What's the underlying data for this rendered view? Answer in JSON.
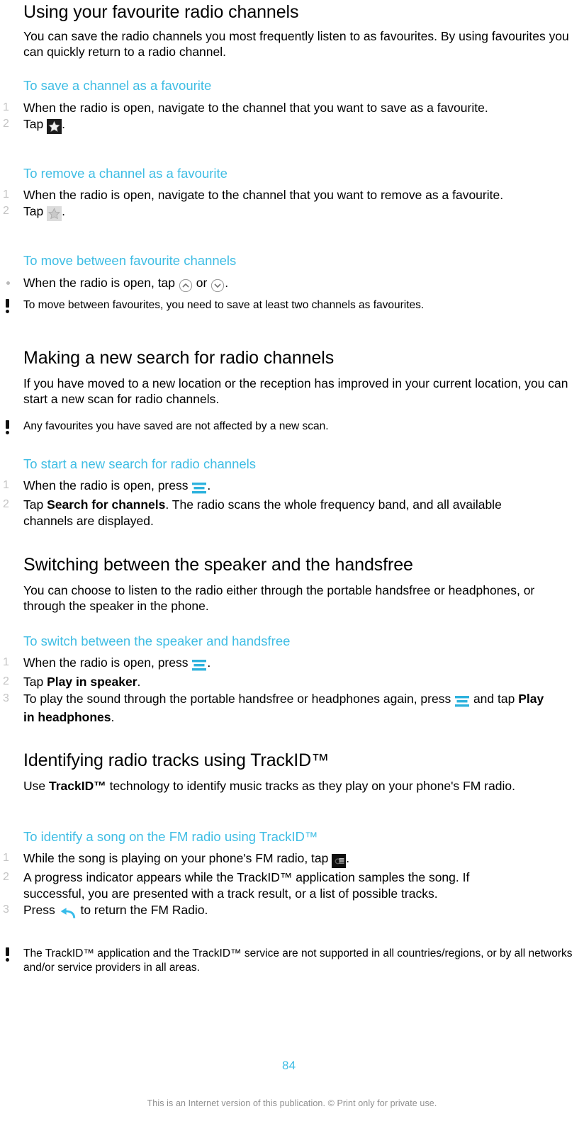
{
  "page": {
    "number": "84",
    "footer_note": "This is an Internet version of this publication. © Print only for private use."
  },
  "accent_color": "#3fbde4",
  "marker_color": "#c3c3c3",
  "sections": [
    {
      "id": "favourites",
      "title": "Using your favourite radio channels",
      "intro": "You can save the radio channels you most frequently listen to as favourites. By using favourites you can quickly return to a radio channel.",
      "procedures": [
        {
          "id": "save-favourite",
          "heading": "To save a channel as a favourite",
          "steps": [
            {
              "marker": "1",
              "text_before": "When the radio is open, navigate to the channel that you want to save as a favourite.",
              "icon": null,
              "text_after": ""
            },
            {
              "marker": "2",
              "text_before": "Tap ",
              "icon": "star-filled-icon",
              "text_after": "."
            }
          ]
        },
        {
          "id": "remove-favourite",
          "heading": "To remove a channel as a favourite",
          "steps": [
            {
              "marker": "1",
              "text_before": "When the radio is open, navigate to the channel that you want to remove as a favourite.",
              "icon": null,
              "text_after": ""
            },
            {
              "marker": "2",
              "text_before": "Tap ",
              "icon": "star-outline-icon",
              "text_after": "."
            }
          ]
        },
        {
          "id": "move-between-favourites",
          "heading": "To move between favourite channels",
          "steps": [
            {
              "marker": "•",
              "text_before": "When the radio is open, tap ",
              "icon": "chevron-up-button-icon",
              "text_middle": " or ",
              "icon2": "chevron-down-button-icon",
              "text_after": "."
            }
          ],
          "note": "To move between favourites, you need to save at least two channels as favourites."
        }
      ]
    },
    {
      "id": "new-search",
      "title": "Making a new search for radio channels",
      "intro": "If you have moved to a new location or the reception has improved in your current location, you can start a new scan for radio channels.",
      "note": "Any favourites you have saved are not affected by a new scan.",
      "procedures": [
        {
          "id": "start-new-search",
          "heading": "To start a new search for radio channels",
          "steps": [
            {
              "marker": "1",
              "text_before": "When the radio is open, press ",
              "icon": "menu-key-icon",
              "text_after": "."
            },
            {
              "marker": "2",
              "text_before": "Tap ",
              "bold": "Search for channels",
              "text_after": ". The radio scans the whole frequency band, and all available channels are displayed."
            }
          ]
        }
      ]
    },
    {
      "id": "speaker-handsfree",
      "title": "Switching between the speaker and the handsfree",
      "intro": "You can choose to listen to the radio either through the portable handsfree or headphones, or through the speaker in the phone.",
      "procedures": [
        {
          "id": "switch-speaker-handsfree",
          "heading": "To switch between the speaker and handsfree",
          "steps": [
            {
              "marker": "1",
              "text_before": "When the radio is open, press ",
              "icon": "menu-key-icon",
              "text_after": "."
            },
            {
              "marker": "2",
              "text_before": "Tap ",
              "bold": "Play in speaker",
              "text_after": "."
            },
            {
              "marker": "3",
              "text_before": "To play the sound through the portable handsfree or headphones again, press ",
              "icon": "menu-key-icon",
              "text_middle": " and tap ",
              "bold": "Play in headphones",
              "text_after": "."
            }
          ]
        }
      ]
    },
    {
      "id": "trackid",
      "title": "Identifying radio tracks using TrackID™",
      "intro_before": "Use ",
      "intro_bold": "TrackID™",
      "intro_after": " technology to identify music tracks as they play on your phone's FM radio.",
      "procedures": [
        {
          "id": "identify-song",
          "heading": "To identify a song on the FM radio using TrackID™",
          "steps": [
            {
              "marker": "1",
              "text_before": "While the song is playing on your phone's FM radio, tap ",
              "icon": "trackid-icon",
              "text_after": "."
            },
            {
              "marker": "2",
              "text_before": "A progress indicator appears while the TrackID™ application samples the song. If successful, you are presented with a track result, or a list of possible tracks.",
              "icon": null,
              "text_after": ""
            },
            {
              "marker": "3",
              "text_before": "Press ",
              "icon": "back-arrow-icon",
              "text_after": " to return the FM Radio."
            }
          ],
          "note": "The TrackID™ application and the TrackID™ service are not supported in all countries/regions, or by all networks and/or service providers in all areas."
        }
      ]
    }
  ]
}
